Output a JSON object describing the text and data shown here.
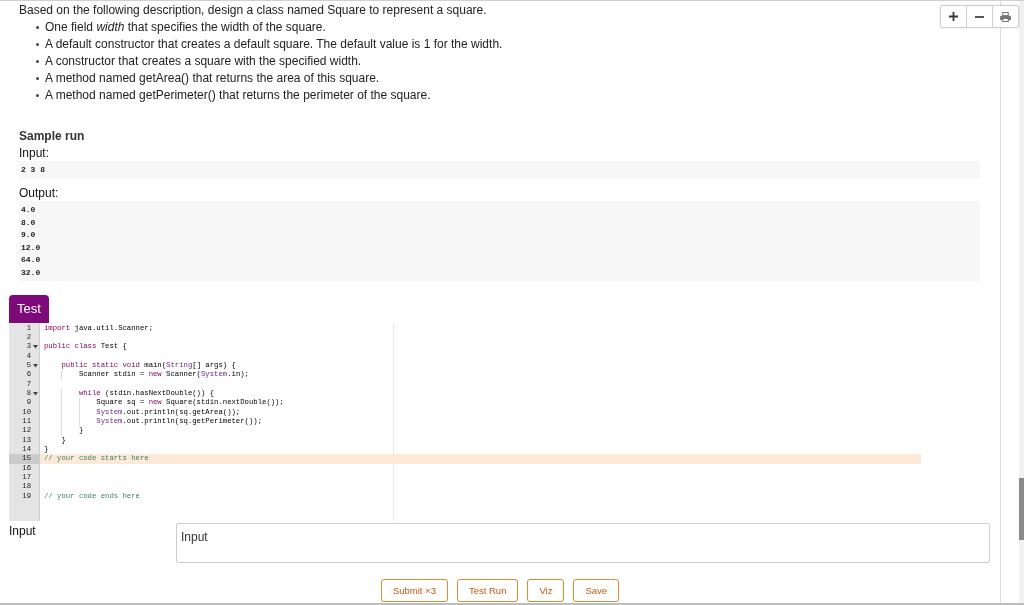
{
  "description": {
    "intro": "Based on the following description, design a class named Square to represent a square.",
    "bullets": [
      "One field *width* that specifies the width of the square.",
      "A default constructor that creates a default square. The default value is 1 for the width.",
      "A constructor that creates a square with the specified width.",
      "A method named getArea() that returns the area of this square.",
      "A method named getPerimeter() that returns the perimeter of the square."
    ]
  },
  "sample_run": {
    "title": "Sample run",
    "input_label": "Input:",
    "input": "2 3 8",
    "output_label": "Output:",
    "output_lines": [
      "4.0",
      "8.0",
      "9.0",
      "12.0",
      "64.0",
      "32.0"
    ]
  },
  "editor": {
    "tab": "Test",
    "lines": [
      {
        "number": "1",
        "foldable": false,
        "active": false,
        "tokens": [
          {
            "kind": "keyword",
            "text": "import"
          },
          {
            "kind": "plain",
            "text": " java.util.Scanner;"
          }
        ]
      },
      {
        "number": "2",
        "foldable": false,
        "active": false
      },
      {
        "number": "3",
        "foldable": true,
        "active": false,
        "tokens": [
          {
            "kind": "keyword",
            "text": "public class"
          },
          {
            "kind": "plain",
            "text": " Test {"
          }
        ]
      },
      {
        "number": "4",
        "foldable": false,
        "active": false
      },
      {
        "number": "5",
        "foldable": true,
        "active": false,
        "tokens": [
          {
            "kind": "keyword",
            "text": "    public static void"
          },
          {
            "kind": "plain",
            "text": " main("
          },
          {
            "kind": "type",
            "text": "String"
          },
          {
            "kind": "plain",
            "text": "[] args) {"
          }
        ]
      },
      {
        "number": "6",
        "foldable": false,
        "active": false,
        "tokens": [
          {
            "kind": "plain",
            "text": "        Scanner stdin = "
          },
          {
            "kind": "keyword",
            "text": "new"
          },
          {
            "kind": "plain",
            "text": " Scanner("
          },
          {
            "kind": "type",
            "text": "System"
          },
          {
            "kind": "plain",
            "text": ".in);"
          }
        ]
      },
      {
        "number": "7",
        "foldable": false,
        "active": false
      },
      {
        "number": "8",
        "foldable": true,
        "active": false,
        "tokens": [
          {
            "kind": "keyword",
            "text": "        while"
          },
          {
            "kind": "plain",
            "text": " (stdin.hasNextDouble()) {"
          }
        ]
      },
      {
        "number": "9",
        "foldable": false,
        "active": false,
        "tokens": [
          {
            "kind": "plain",
            "text": "            Square sq = "
          },
          {
            "kind": "keyword",
            "text": "new"
          },
          {
            "kind": "plain",
            "text": " Square(stdin.nextDouble());"
          }
        ]
      },
      {
        "number": "10",
        "foldable": false,
        "active": false,
        "tokens": [
          {
            "kind": "type",
            "text": "            System"
          },
          {
            "kind": "plain",
            "text": ".out.println(sq.getArea());"
          }
        ]
      },
      {
        "number": "11",
        "foldable": false,
        "active": false,
        "tokens": [
          {
            "kind": "type",
            "text": "            System"
          },
          {
            "kind": "plain",
            "text": ".out.println(sq.getPerimeter());"
          }
        ]
      },
      {
        "number": "12",
        "foldable": false,
        "active": false,
        "tokens": [
          {
            "kind": "plain",
            "text": "        }"
          }
        ]
      },
      {
        "number": "13",
        "foldable": false,
        "active": false,
        "tokens": [
          {
            "kind": "plain",
            "text": "    }"
          }
        ]
      },
      {
        "number": "14",
        "foldable": false,
        "active": false,
        "tokens": [
          {
            "kind": "plain",
            "text": "}"
          }
        ]
      },
      {
        "number": "15",
        "foldable": false,
        "active": true,
        "tokens": [
          {
            "kind": "comment",
            "text": "// your code starts here"
          }
        ]
      },
      {
        "number": "16",
        "foldable": false,
        "active": false
      },
      {
        "number": "17",
        "foldable": false,
        "active": false
      },
      {
        "number": "18",
        "foldable": false,
        "active": false
      },
      {
        "number": "19",
        "foldable": false,
        "active": false,
        "tokens": [
          {
            "kind": "comment",
            "text": "// your code ends here"
          }
        ]
      }
    ]
  },
  "input": {
    "label": "Input",
    "placeholder": "Input"
  },
  "buttons": [
    "Submit ×3",
    "Test Run",
    "Viz",
    "Save"
  ]
}
